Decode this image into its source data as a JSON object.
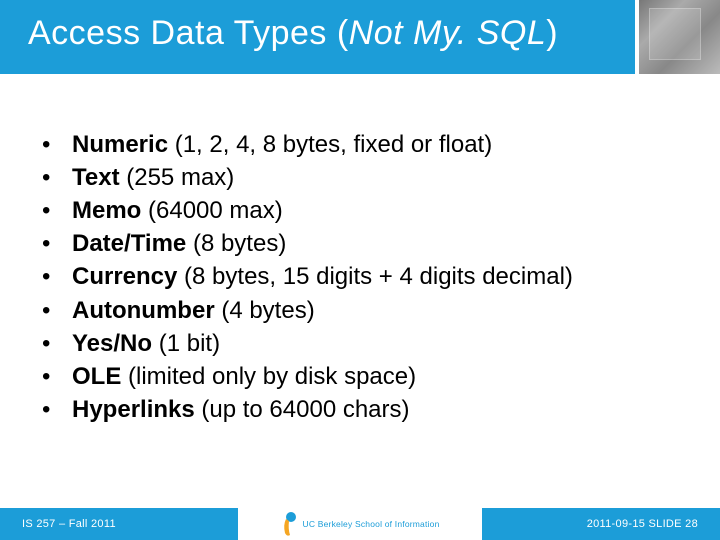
{
  "title": {
    "plain": "Access Data Types (",
    "italic": "Not My. SQL",
    "close": ")"
  },
  "bullets": [
    {
      "bold": "Numeric",
      "rest": " (1, 2, 4, 8 bytes, fixed or float)"
    },
    {
      "bold": "Text",
      "rest": " (255 max)"
    },
    {
      "bold": "Memo",
      "rest": " (64000 max)"
    },
    {
      "bold": "Date/Time",
      "rest": " (8 bytes)"
    },
    {
      "bold": "Currency",
      "rest": " (8 bytes, 15 digits + 4 digits decimal)"
    },
    {
      "bold": "Autonumber",
      "rest": " (4 bytes)"
    },
    {
      "bold": "Yes/No",
      "rest": " (1 bit)"
    },
    {
      "bold": "OLE",
      "rest": " (limited only by disk space)"
    },
    {
      "bold": "Hyperlinks",
      "rest": " (up to 64000 chars)"
    }
  ],
  "footer": {
    "left": "IS 257 – Fall 2011",
    "logo_line1": "UC Berkeley School of Information",
    "right": "2011-09-15 SLIDE 28"
  }
}
